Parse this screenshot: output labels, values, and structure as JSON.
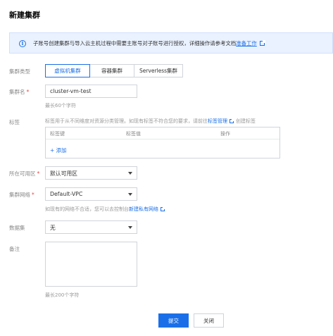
{
  "page": {
    "title": "新建集群"
  },
  "notice": {
    "text": "子账号创建集群与导入云主机过程中需要主账号对子账号进行授权，详细操作请参考文档",
    "link": "准备工作"
  },
  "form": {
    "cluster_type": {
      "label": "集群类型",
      "options": [
        "虚拟机集群",
        "容器集群",
        "Serverless集群"
      ],
      "selected": "虚拟机集群"
    },
    "cluster_name": {
      "label": "集群名",
      "required_mark": "*",
      "value": "cluster-vm-test",
      "hint": "最长60个字符"
    },
    "tags": {
      "label": "标签",
      "hint_prefix": "标签用于从不同维度对资源分类管理。如现有标签不符合您的要求，请前往",
      "hint_link": "标签管理",
      "hint_suffix": "创建标签",
      "columns": [
        "标签键",
        "标签值",
        "操作"
      ],
      "add_label": "+ 添加"
    },
    "zone": {
      "label": "所在可用区",
      "required_mark": "*",
      "value": "默认可用区"
    },
    "network": {
      "label": "集群网络",
      "required_mark": "*",
      "value": "Default-VPC",
      "hint_prefix": "如现有的网络不合适，您可以去控制台",
      "hint_link": "新建私有网络"
    },
    "dataset": {
      "label": "数据集",
      "value": "无"
    },
    "remark": {
      "label": "备注",
      "value": "",
      "hint": "最长200个字符"
    }
  },
  "actions": {
    "submit": "提交",
    "close": "关闭"
  },
  "colors": {
    "primary": "#1a6fe8",
    "notice_bg": "#eaf2ff",
    "required": "#e54545"
  }
}
